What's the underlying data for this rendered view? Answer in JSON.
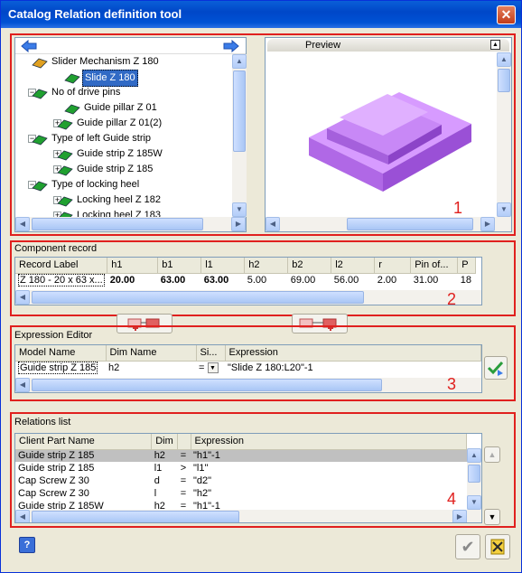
{
  "window": {
    "title": "Catalog Relation definition tool",
    "close_glyph": "✕"
  },
  "tree": {
    "items": [
      {
        "label": "Slider Mechanism Z 180",
        "expander": "",
        "icon": "mechanism-icon"
      },
      {
        "label": "Slide Z 180",
        "expander": "",
        "icon": "slide-icon",
        "selected": true
      },
      {
        "label": "No of drive pins",
        "expander": "−",
        "icon": "group-icon"
      },
      {
        "label": "Guide pillar Z 01",
        "expander": "",
        "icon": "pillar-icon"
      },
      {
        "label": "Guide pillar Z 01(2)",
        "expander": "+",
        "icon": "pillar-icon"
      },
      {
        "label": "Type of left Guide strip",
        "expander": "−",
        "icon": "group-icon"
      },
      {
        "label": "Guide strip Z 185W",
        "expander": "+",
        "icon": "strip-icon"
      },
      {
        "label": "Guide strip Z 185",
        "expander": "+",
        "icon": "strip-icon"
      },
      {
        "label": "Type of locking heel",
        "expander": "−",
        "icon": "group-icon"
      },
      {
        "label": "Locking heel Z 182",
        "expander": "+",
        "icon": "heel-icon"
      },
      {
        "label": "Locking heel Z 183",
        "expander": "+",
        "icon": "heel-icon"
      }
    ]
  },
  "preview": {
    "title": "Preview"
  },
  "annotations": {
    "n1": "1",
    "n2": "2",
    "n3": "3",
    "n4": "4"
  },
  "component_record": {
    "label": "Component record",
    "columns": [
      "Record Label",
      "h1",
      "b1",
      "l1",
      "h2",
      "b2",
      "l2",
      "r",
      "Pin of...",
      "P"
    ],
    "row": [
      "Z 180 - 20 x 63 x...",
      "20.00",
      "63.00",
      "63.00",
      "5.00",
      "69.00",
      "56.00",
      "2.00",
      "31.00",
      "18"
    ]
  },
  "expression_editor": {
    "label": "Expression Editor",
    "columns": [
      "Model Name",
      "Dim Name",
      "Si...",
      "Expression"
    ],
    "row": {
      "model": "Guide strip Z 185",
      "dim": "h2",
      "sign": "=",
      "expression": "\"Slide Z 180:L20\"-1"
    }
  },
  "relations": {
    "label": "Relations list",
    "columns": [
      "Client Part Name",
      "Dim",
      "",
      "Expression"
    ],
    "rows": [
      {
        "part": "Guide strip Z 185",
        "dim": "h2",
        "op": "=",
        "expr": "\"h1\"-1"
      },
      {
        "part": "Guide strip Z 185",
        "dim": "l1",
        "op": ">",
        "expr": "\"l1\""
      },
      {
        "part": "Cap Screw Z 30",
        "dim": "d",
        "op": "=",
        "expr": "\"d2\""
      },
      {
        "part": "Cap Screw Z 30",
        "dim": "l",
        "op": "=",
        "expr": "\"h2\""
      },
      {
        "part": "Guide strip Z 185W",
        "dim": "h2",
        "op": "=",
        "expr": "\"h1\"-1"
      }
    ]
  },
  "footer": {
    "help_glyph": "?",
    "ok_glyph": "✔"
  },
  "colors": {
    "title": "#0052d4",
    "selection": "#316ac5",
    "annotation": "#e0201e",
    "preview_part": "#c080f0"
  }
}
